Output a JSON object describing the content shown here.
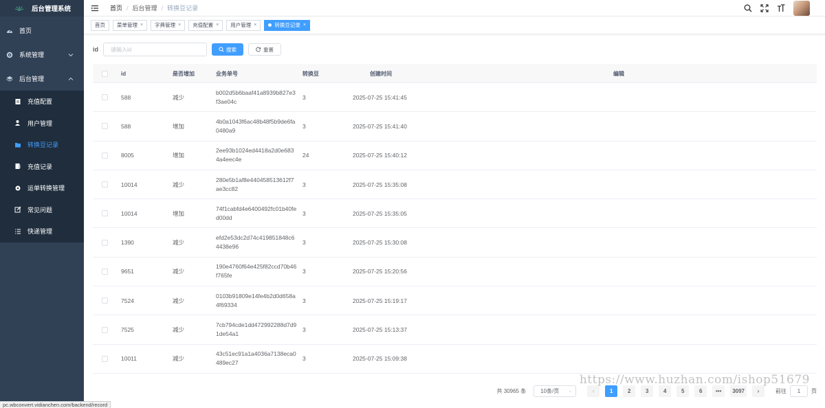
{
  "app": {
    "title": "后台管理系统"
  },
  "sidebar": {
    "items": [
      {
        "label": "首页",
        "icon": "dashboard-icon"
      },
      {
        "label": "系统管理",
        "icon": "gear-icon"
      },
      {
        "label": "后台管理",
        "icon": "layers-icon"
      }
    ],
    "submenu": [
      {
        "label": "充值配置",
        "icon": "document-icon"
      },
      {
        "label": "用户管理",
        "icon": "user-icon"
      },
      {
        "label": "转换豆记录",
        "icon": "folder-icon"
      },
      {
        "label": "充值记录",
        "icon": "receipt-icon"
      },
      {
        "label": "运单转换管理",
        "icon": "gear-icon"
      },
      {
        "label": "常见问题",
        "icon": "edit-icon"
      },
      {
        "label": "快递管理",
        "icon": "list-icon"
      }
    ]
  },
  "status_url": "pc.wbconvert.vidianchen.com/backend/record",
  "breadcrumb": [
    "首页",
    "后台管理",
    "转换豆记录"
  ],
  "tags": [
    {
      "label": "首页"
    },
    {
      "label": "菜单管理"
    },
    {
      "label": "字典管理"
    },
    {
      "label": "充值配置"
    },
    {
      "label": "用户管理"
    },
    {
      "label": "转换豆记录"
    }
  ],
  "search": {
    "label": "id",
    "placeholder": "请输入id",
    "search_button": "搜索",
    "reset_button": "重置"
  },
  "table": {
    "headers": [
      "id",
      "是否增加",
      "业务单号",
      "转换豆",
      "创建时间",
      "编辑"
    ],
    "rows": [
      {
        "id": "588",
        "inc": "减少",
        "no": "b002d5b6baaf41a8939b827e3f3ae04c",
        "bean": "3",
        "time": "2025-07-25 15:41:45"
      },
      {
        "id": "588",
        "inc": "增加",
        "no": "4b0a1043f6ac48b48f5b9de6fa0480a9",
        "bean": "3",
        "time": "2025-07-25 15:41:40"
      },
      {
        "id": "8005",
        "inc": "增加",
        "no": "2ee93b1024ed4418a2d0e6834a4eec4e",
        "bean": "24",
        "time": "2025-07-25 15:40:12"
      },
      {
        "id": "10014",
        "inc": "减少",
        "no": "280e5b1af8e440458513612f7ae3cc82",
        "bean": "3",
        "time": "2025-07-25 15:35:08"
      },
      {
        "id": "10014",
        "inc": "增加",
        "no": "74f1cabfd4e6400492fc01b40fed00dd",
        "bean": "3",
        "time": "2025-07-25 15:35:05"
      },
      {
        "id": "1390",
        "inc": "减少",
        "no": "efd2e53dc2d74c419851848c64438e96",
        "bean": "3",
        "time": "2025-07-25 15:30:08"
      },
      {
        "id": "9651",
        "inc": "减少",
        "no": "190e4760f64e425f82ccd70b46f765fe",
        "bean": "3",
        "time": "2025-07-25 15:20:56"
      },
      {
        "id": "7524",
        "inc": "减少",
        "no": "0103b91809e14fe4b2d0d658a4f69334",
        "bean": "3",
        "time": "2025-07-25 15:19:17"
      },
      {
        "id": "7525",
        "inc": "减少",
        "no": "7cb794cde1dd472992288d7d91de54a1",
        "bean": "3",
        "time": "2025-07-25 15:13:37"
      },
      {
        "id": "10011",
        "inc": "减少",
        "no": "43c51ec91a1a4036a7138eca0489ec27",
        "bean": "3",
        "time": "2025-07-25 15:09:38"
      }
    ]
  },
  "pagination": {
    "total": "共 30965 条",
    "page_size": "10条/页",
    "pages": [
      "1",
      "2",
      "3",
      "4",
      "5",
      "6"
    ],
    "ellipsis": "•••",
    "last": "3097",
    "jump_label": "前往",
    "jump_value": "1",
    "jump_suffix": "页"
  },
  "watermark": "https://www.huzhan.com/ishop51679",
  "colors": {
    "sidebar": "#304156",
    "accent": "#409eff"
  }
}
